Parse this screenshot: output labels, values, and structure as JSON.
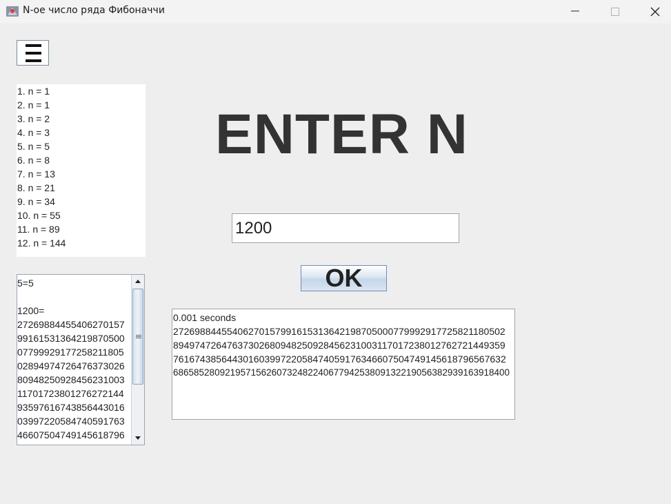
{
  "window": {
    "title": "N-ое число ряда Фибоначчи",
    "controls": [
      "minimize",
      "maximize",
      "close"
    ]
  },
  "menu_button": {
    "icon": "hamburger-menu-icon"
  },
  "history_list": [
    "1. n = 1",
    "2. n = 1",
    "3. n = 2",
    "4. n = 3",
    "5. n = 5",
    "6. n = 8",
    "7. n = 13",
    "8. n = 21",
    "9. n = 34",
    "10. n = 55",
    "11. n = 89",
    "12. n = 144"
  ],
  "results_log": {
    "text": "5 = 5\n\n1200 =\n2726988445540627015 7\n99161531364219870500\n07799929177258211805\n02894974726476373026\n80948250928456231003\n11701723801276272144\n93597616743856443016\n03997220584740591763\n46607504749145618796"
  },
  "heading": "ENTER N",
  "input": {
    "value": "1200"
  },
  "ok_button": {
    "label": "OK"
  },
  "output": {
    "lines": [
      "0.001 seconds",
      "27269884455406270157991615313642198705000779992917725821180502",
      "89497472647637302680948250928456231003117017238012762721449359",
      "76167438564430160399722058474059176346607504749145618796567632",
      "68658528092195715626073248224067794253809132219056382939163918400"
    ]
  }
}
